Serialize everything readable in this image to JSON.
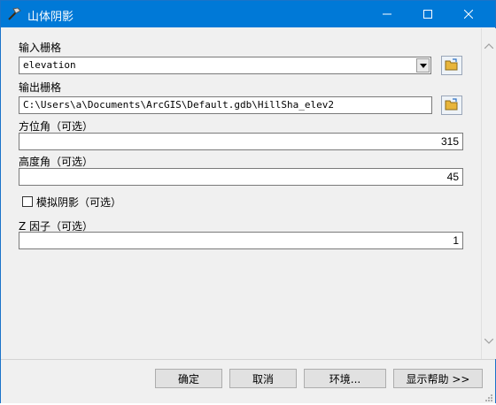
{
  "window": {
    "title": "山体阴影"
  },
  "form": {
    "input_raster": {
      "label": "输入栅格",
      "value": "elevation"
    },
    "output_raster": {
      "label": "输出栅格",
      "value": "C:\\Users\\a\\Documents\\ArcGIS\\Default.gdb\\HillSha_elev2"
    },
    "azimuth": {
      "label": "方位角（可选）",
      "value": "315"
    },
    "altitude": {
      "label": "高度角（可选）",
      "value": "45"
    },
    "model_shadows": {
      "label": "模拟阴影（可选）",
      "checked": false
    },
    "z_factor": {
      "label": "Z 因子（可选）",
      "value": "1"
    }
  },
  "buttons": {
    "ok": "确定",
    "cancel": "取消",
    "environments": "环境...",
    "show_help": "显示帮助 >>"
  },
  "icons": {
    "app": "hammer-icon",
    "folder": "folder-open-icon",
    "dropdown": "chevron-down-icon"
  }
}
